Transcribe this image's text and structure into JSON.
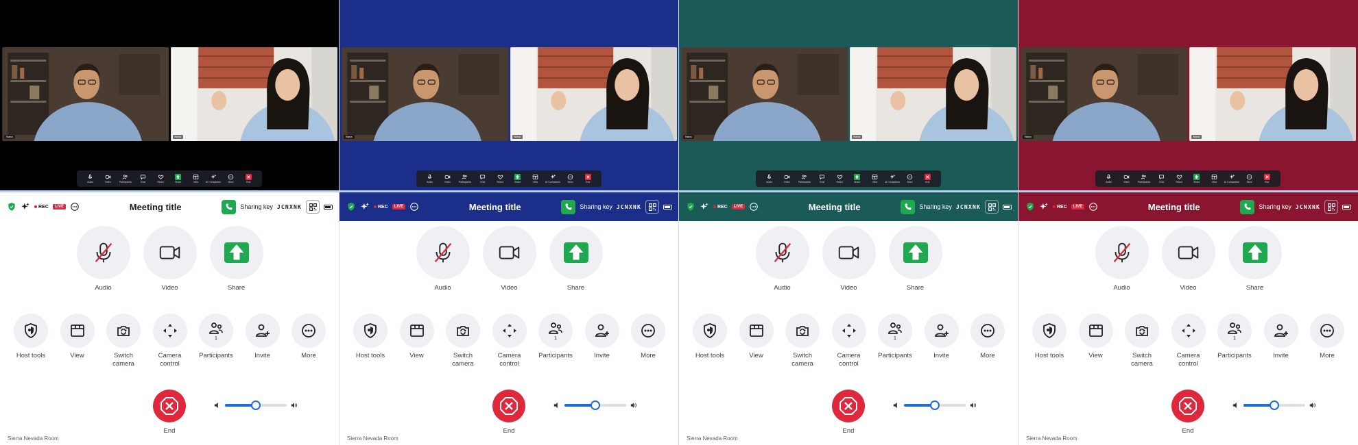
{
  "panels": [
    {
      "theme": "black",
      "video_bg": "#000000",
      "header_bg": "#ffffff",
      "header_fg": "#1a1a1a",
      "header_shield": "#1fa84f"
    },
    {
      "theme": "blue",
      "video_bg": "#1a2e8a",
      "header_bg": "#1a2e8a",
      "header_fg": "#ffffff",
      "header_shield": "#1fa84f"
    },
    {
      "theme": "teal",
      "video_bg": "#1a5a57",
      "header_bg": "#1a5a57",
      "header_fg": "#ffffff",
      "header_shield": "#1fa84f"
    },
    {
      "theme": "crimson",
      "video_bg": "#8a1530",
      "header_bg": "#8a1530",
      "header_fg": "#ffffff",
      "header_shield": "#1fa84f"
    }
  ],
  "video": {
    "tiles": [
      {
        "name": "Nana",
        "icon": "participant-video-male"
      },
      {
        "name": "Nana",
        "icon": "participant-video-female"
      }
    ]
  },
  "mini_toolbar": [
    {
      "key": "audio",
      "label": "Audio",
      "icon": "mic-icon"
    },
    {
      "key": "video",
      "label": "Video",
      "icon": "camera-icon"
    },
    {
      "key": "participants",
      "label": "Participants",
      "icon": "people-icon"
    },
    {
      "key": "chat",
      "label": "Chat",
      "icon": "chat-icon"
    },
    {
      "key": "react",
      "label": "React",
      "icon": "heart-icon"
    },
    {
      "key": "share",
      "label": "Share",
      "icon": "share-up-icon"
    },
    {
      "key": "view",
      "label": "View",
      "icon": "grid-icon"
    },
    {
      "key": "ai",
      "label": "AI Companion",
      "icon": "sparkle-icon"
    },
    {
      "key": "more",
      "label": "More",
      "icon": "more-icon"
    },
    {
      "key": "end",
      "label": "End",
      "icon": "end-icon"
    }
  ],
  "header": {
    "rec": "REC",
    "live": "LIVE",
    "title": "Meeting title",
    "sharing_key_label": "Sharing key",
    "sharing_key": "JCNXNK"
  },
  "main_controls": [
    {
      "key": "audio",
      "label": "Audio",
      "icon": "mic-muted-icon",
      "state": "muted"
    },
    {
      "key": "video",
      "label": "Video",
      "icon": "video-camera-icon"
    },
    {
      "key": "share",
      "label": "Share",
      "icon": "share-up-icon"
    }
  ],
  "secondary_controls": [
    {
      "key": "host-tools",
      "label": "Host tools",
      "icon": "shield-icon",
      "badge": ""
    },
    {
      "key": "view",
      "label": "View",
      "icon": "view-grid-icon",
      "badge": ""
    },
    {
      "key": "switch-camera",
      "label": "Switch\ncamera",
      "icon": "switch-camera-icon",
      "badge": ""
    },
    {
      "key": "camera-control",
      "label": "Camera\ncontrol",
      "icon": "dpad-icon",
      "badge": ""
    },
    {
      "key": "participants",
      "label": "Participants",
      "icon": "people-icon",
      "badge": "1"
    },
    {
      "key": "invite",
      "label": "Invite",
      "icon": "add-person-icon",
      "badge": ""
    },
    {
      "key": "more",
      "label": "More",
      "icon": "more-icon",
      "badge": ""
    }
  ],
  "end": {
    "label": "End"
  },
  "volume": {
    "level": 0.5
  },
  "room": "Sierra Nevada Room",
  "colors": {
    "accent": "#1c6ce0",
    "green": "#1fa84f",
    "red": "#e0283c"
  }
}
